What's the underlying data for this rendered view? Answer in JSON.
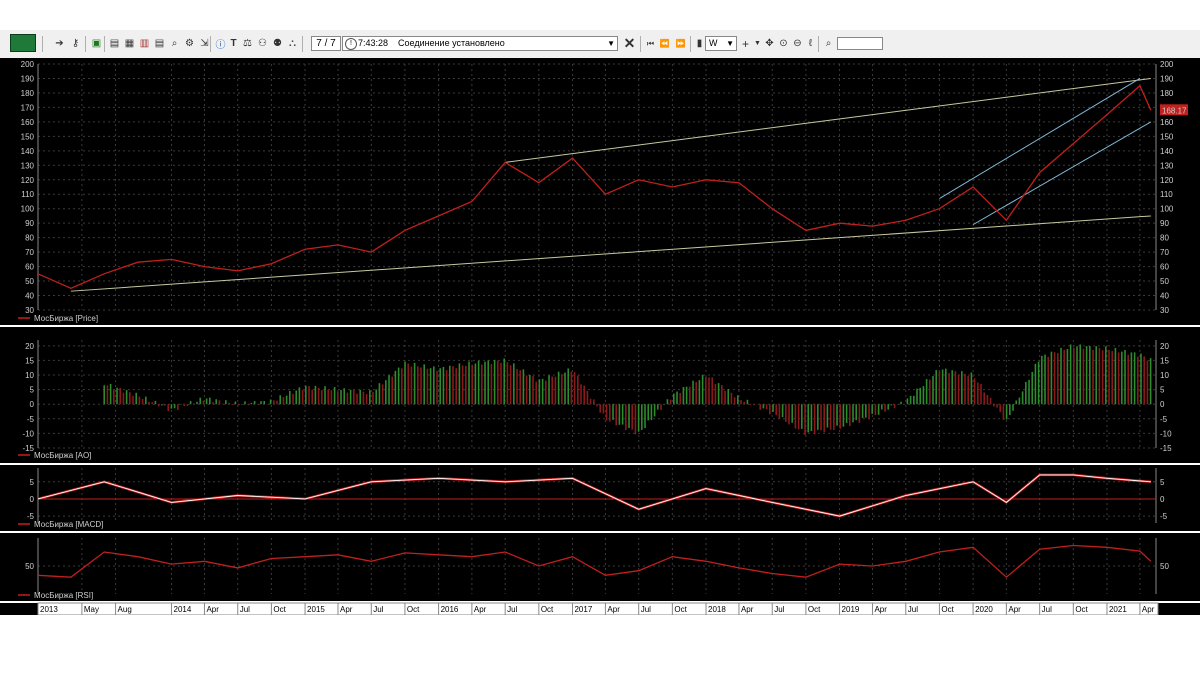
{
  "toolbar": {
    "counter": "7 / 7",
    "status_time": "7:43:28",
    "status_message": "Соединение установлено",
    "interval": "W",
    "search_value": ""
  },
  "price_panel": {
    "legend": "МосБиржа [Price]",
    "current_price_label": "168.17",
    "y_ticks": [
      "200",
      "190",
      "180",
      "170",
      "160",
      "150",
      "140",
      "130",
      "120",
      "110",
      "100",
      "90",
      "80",
      "70",
      "60",
      "50",
      "40",
      "30"
    ]
  },
  "ao_panel": {
    "legend": "МосБиржа [AO]",
    "y_ticks": [
      "20",
      "15",
      "10",
      "5",
      "0",
      "-5",
      "-10",
      "-15"
    ]
  },
  "macd_panel": {
    "legend": "МосБиржа [MACD]",
    "y_ticks": [
      "5",
      "0",
      "-5"
    ]
  },
  "rsi_panel": {
    "legend": "МосБиржа [RSI]",
    "y_ticks": [
      "50"
    ]
  },
  "x_axis": {
    "labels": [
      "2013",
      "May",
      "Aug",
      "2014",
      "Apr",
      "Jul",
      "Oct",
      "2015",
      "Apr",
      "Jul",
      "Oct",
      "2016",
      "Apr",
      "Jul",
      "Oct",
      "2017",
      "Apr",
      "Jul",
      "Oct",
      "2018",
      "Apr",
      "Jul",
      "Oct",
      "2019",
      "Apr",
      "Jul",
      "Oct",
      "2020",
      "Apr",
      "Jul",
      "Oct",
      "2021",
      "Apr"
    ]
  },
  "colors": {
    "background": "#000000",
    "grid": "#3a3a3a",
    "price_line": "#c0201e",
    "trend_line": "#c8c8a0",
    "channel_line": "#7fb8d8",
    "ao_up": "#2e8b2e",
    "ao_down": "#8b1a1a",
    "macd_signal": "#ffffff",
    "macd_line": "#c0201e"
  },
  "chart_data": {
    "type": "line",
    "symbol": "МосБиржа",
    "timeframe": "W",
    "x_range": [
      "2013-01",
      "2021-05"
    ],
    "price": {
      "ylim": [
        30,
        200
      ],
      "x": [
        "2013-01",
        "2013-04",
        "2013-07",
        "2013-10",
        "2014-01",
        "2014-04",
        "2014-07",
        "2014-10",
        "2015-01",
        "2015-04",
        "2015-07",
        "2015-10",
        "2016-01",
        "2016-04",
        "2016-07",
        "2016-10",
        "2017-01",
        "2017-04",
        "2017-07",
        "2017-10",
        "2018-01",
        "2018-04",
        "2018-07",
        "2018-10",
        "2019-01",
        "2019-04",
        "2019-07",
        "2019-10",
        "2020-01",
        "2020-04",
        "2020-07",
        "2020-10",
        "2021-01",
        "2021-04",
        "2021-05"
      ],
      "values": [
        55,
        45,
        55,
        63,
        65,
        60,
        57,
        62,
        72,
        75,
        70,
        85,
        95,
        105,
        132,
        118,
        135,
        110,
        120,
        115,
        120,
        118,
        100,
        85,
        90,
        88,
        92,
        100,
        115,
        92,
        125,
        145,
        165,
        185,
        168
      ]
    },
    "ao": {
      "ylim": [
        -15,
        22
      ],
      "x": [
        "2013-01",
        "2013-04",
        "2013-07",
        "2013-10",
        "2014-01",
        "2014-04",
        "2014-07",
        "2014-10",
        "2015-01",
        "2015-04",
        "2015-07",
        "2015-10",
        "2016-01",
        "2016-04",
        "2016-07",
        "2016-10",
        "2017-01",
        "2017-04",
        "2017-07",
        "2017-10",
        "2018-01",
        "2018-04",
        "2018-07",
        "2018-10",
        "2019-01",
        "2019-04",
        "2019-07",
        "2019-10",
        "2020-01",
        "2020-04",
        "2020-07",
        "2020-10",
        "2021-01",
        "2021-04",
        "2021-05"
      ],
      "values": [
        0,
        0,
        7,
        3,
        -2,
        2,
        0,
        1,
        6,
        5,
        4,
        14,
        12,
        14,
        15,
        8,
        12,
        -5,
        -10,
        3,
        10,
        2,
        -3,
        -10,
        -8,
        -4,
        1,
        12,
        10,
        -6,
        16,
        20,
        19,
        17,
        15
      ]
    },
    "macd": {
      "ylim": [
        -7,
        9
      ],
      "x": [
        "2013-01",
        "2013-07",
        "2014-01",
        "2014-07",
        "2015-01",
        "2015-07",
        "2016-01",
        "2016-07",
        "2017-01",
        "2017-07",
        "2018-01",
        "2018-07",
        "2019-01",
        "2019-07",
        "2020-01",
        "2020-04",
        "2020-07",
        "2020-10",
        "2021-01",
        "2021-05"
      ],
      "values": [
        0,
        5,
        -1,
        1,
        0,
        5,
        6,
        5,
        6,
        -3,
        3,
        -1,
        -5,
        1,
        5,
        -1,
        7,
        7,
        6,
        5
      ]
    },
    "rsi": {
      "ylim": [
        20,
        80
      ],
      "x": [
        "2013-01",
        "2013-04",
        "2013-07",
        "2013-10",
        "2014-01",
        "2014-04",
        "2014-07",
        "2014-10",
        "2015-01",
        "2015-04",
        "2015-07",
        "2015-10",
        "2016-01",
        "2016-04",
        "2016-07",
        "2016-10",
        "2017-01",
        "2017-04",
        "2017-07",
        "2017-10",
        "2018-01",
        "2018-04",
        "2018-07",
        "2018-10",
        "2019-01",
        "2019-04",
        "2019-07",
        "2019-10",
        "2020-01",
        "2020-04",
        "2020-07",
        "2020-10",
        "2021-01",
        "2021-04",
        "2021-05"
      ],
      "values": [
        40,
        38,
        65,
        60,
        52,
        55,
        48,
        58,
        60,
        62,
        55,
        64,
        62,
        60,
        65,
        50,
        60,
        40,
        45,
        60,
        55,
        48,
        42,
        38,
        52,
        50,
        55,
        65,
        70,
        38,
        68,
        72,
        70,
        66,
        55
      ]
    }
  }
}
